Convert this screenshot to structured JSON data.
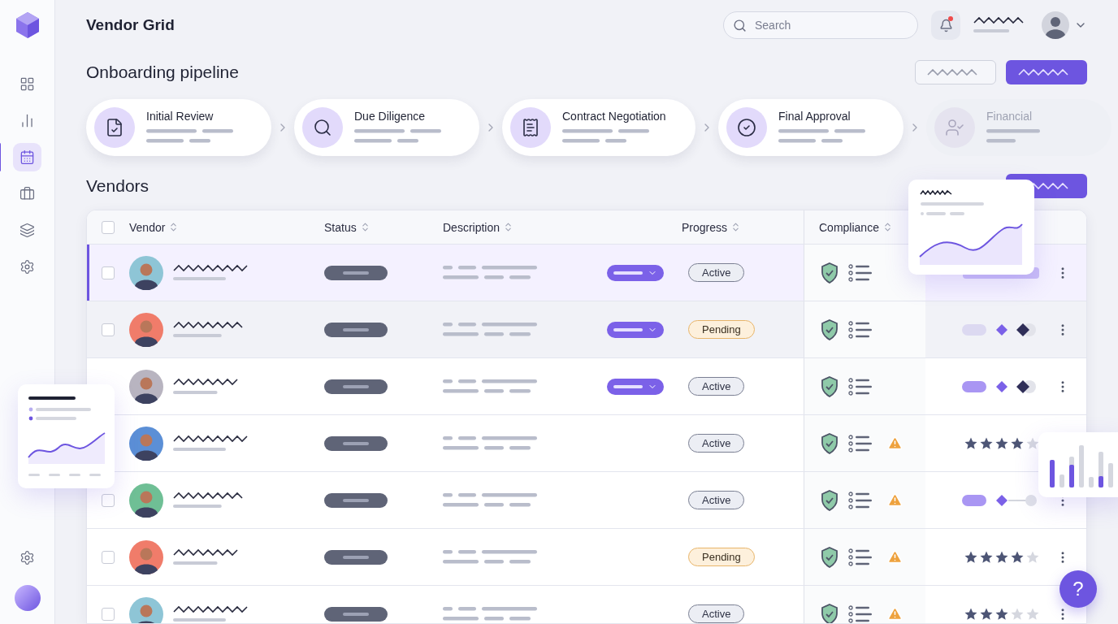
{
  "header": {
    "title": "Vendor Grid",
    "search": {
      "placeholder": "Search"
    },
    "notification": true
  },
  "pipeline": {
    "title": "Onboarding pipeline",
    "stages": [
      {
        "label": "Initial Review",
        "disabled": false
      },
      {
        "label": "Due Diligence",
        "disabled": false
      },
      {
        "label": "Contract Negotiation",
        "disabled": false
      },
      {
        "label": "Final Approval",
        "disabled": false
      },
      {
        "label": "Financial",
        "disabled": true
      }
    ]
  },
  "vendors": {
    "title": "Vendors",
    "select_all": {
      "checked": false
    },
    "columns": [
      "Vendor",
      "Status",
      "Description",
      "Progress",
      "Compliance"
    ],
    "rows": [
      {
        "checked": false,
        "selected": true,
        "hovered": false,
        "color": "#8ec5d6",
        "dropdown": true,
        "progress": "Active",
        "pending": false,
        "warning": false,
        "kind": "bar",
        "menu": true
      },
      {
        "checked": false,
        "selected": false,
        "hovered": true,
        "color": "#f07c6a",
        "dropdown": true,
        "progress": "Pending",
        "pending": true,
        "warning": false,
        "kind": "toggle",
        "menu": true
      },
      {
        "selected": false,
        "hovered": false,
        "color": "#b8b4c0",
        "dropdown": true,
        "progress": "Active",
        "pending": false,
        "warning": false,
        "kind": "toggle",
        "menu": true
      },
      {
        "selected": false,
        "hovered": false,
        "color": "#5b8fd6",
        "dropdown": false,
        "progress": "Active",
        "pending": false,
        "warning": true,
        "kind": "stars",
        "stars": 4
      },
      {
        "checked": false,
        "selected": false,
        "hovered": false,
        "color": "#6fbf95",
        "dropdown": false,
        "progress": "Active",
        "pending": false,
        "warning": true,
        "kind": "toggle",
        "menu": true
      },
      {
        "checked": false,
        "selected": false,
        "hovered": false,
        "color": "#f07c6a",
        "dropdown": false,
        "progress": "Pending",
        "pending": true,
        "warning": true,
        "kind": "stars",
        "stars": 4,
        "menu": true
      },
      {
        "checked": false,
        "selected": false,
        "hovered": false,
        "color": "#8ec5d6",
        "dropdown": false,
        "progress": "Active",
        "pending": false,
        "warning": true,
        "kind": "stars",
        "stars": 3,
        "menu": true
      }
    ]
  },
  "help": {
    "label": "?"
  }
}
